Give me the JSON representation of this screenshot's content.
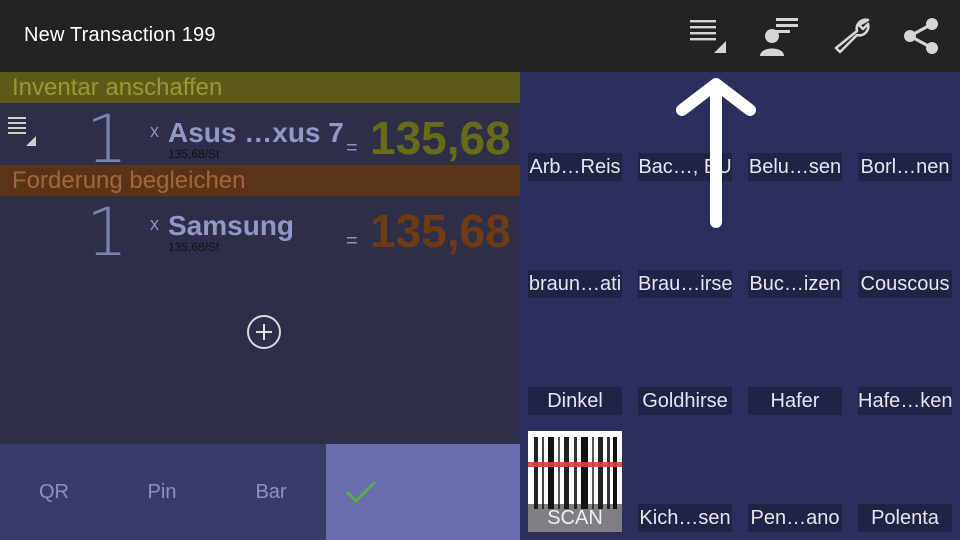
{
  "app": {
    "title": "New Transaction 199",
    "actions": [
      {
        "name": "list-menu-icon"
      },
      {
        "name": "person-list-icon"
      },
      {
        "name": "wrench-icon"
      },
      {
        "name": "share-icon"
      }
    ]
  },
  "transaction": {
    "groups": [
      {
        "account": "Inventar anschaffen",
        "account_color": "#5c5a17",
        "quantity": "1",
        "times": "x",
        "item": "Asus …xus 7",
        "unit_price": "135,68/St",
        "equals": "=",
        "amount": "135,68"
      },
      {
        "account": "Forderung begleichen",
        "account_color": "#5b3417",
        "quantity": "1",
        "times": "x",
        "item": "Samsung",
        "unit_price": "135,68/St",
        "equals": "=",
        "amount": "135,68"
      }
    ]
  },
  "bottom_bar": {
    "qr": "QR",
    "pin": "Pin",
    "bar": "Bar",
    "confirm_icon": "check-icon"
  },
  "products": [
    "Arb…Reis",
    "Bac…, EU",
    "Belu…sen",
    "Borl…nen",
    "braun…ati",
    "Brau…irse",
    "Buc…izen",
    "Couscous",
    "Dinkel",
    "Goldhirse",
    "Hafer",
    "Hafe…ken",
    "Kich…sen",
    "Pen…ano",
    "Polenta"
  ],
  "scan": {
    "label": "SCAN",
    "icon": "barcode-icon"
  }
}
